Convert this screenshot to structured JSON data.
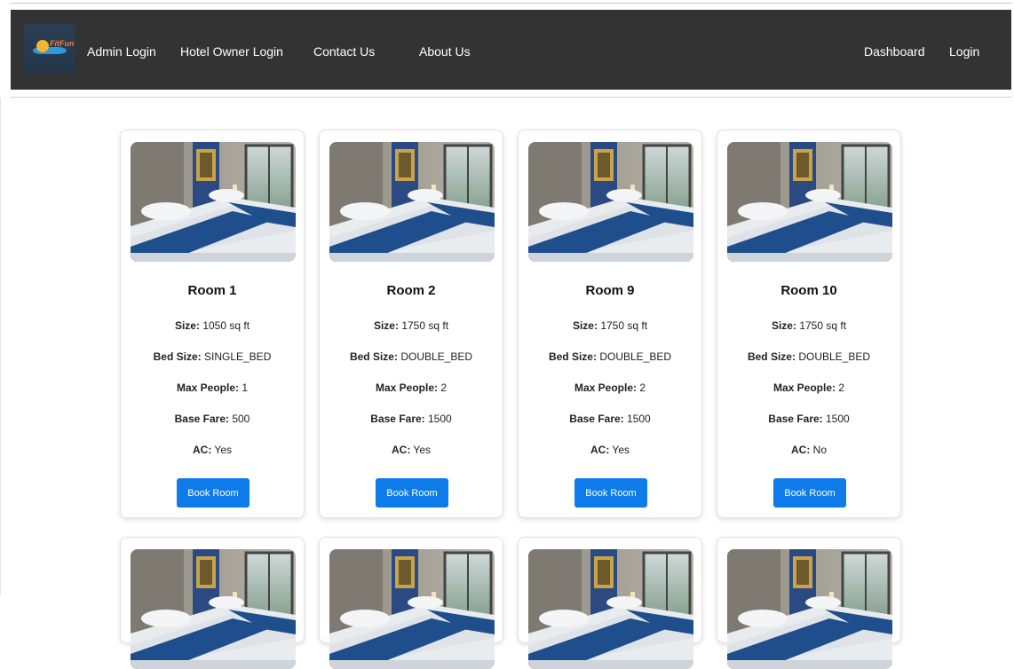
{
  "nav": {
    "logo_text": "FitFun",
    "links_left": [
      "Admin Login",
      "Hotel Owner Login",
      "Contact Us",
      "About Us"
    ],
    "links_right": [
      "Dashboard",
      "Login"
    ]
  },
  "labels": {
    "size": "Size:",
    "bed_size": "Bed Size:",
    "max_people": "Max People:",
    "base_fare": "Base Fare:",
    "ac": "AC:",
    "book_button": "Book Room"
  },
  "rooms": [
    {
      "title": "Room 1",
      "size": "1050 sq ft",
      "bed_size": "SINGLE_BED",
      "max_people": "1",
      "base_fare": "500",
      "ac": "Yes"
    },
    {
      "title": "Room 2",
      "size": "1750 sq ft",
      "bed_size": "DOUBLE_BED",
      "max_people": "2",
      "base_fare": "1500",
      "ac": "Yes"
    },
    {
      "title": "Room 9",
      "size": "1750 sq ft",
      "bed_size": "DOUBLE_BED",
      "max_people": "2",
      "base_fare": "1500",
      "ac": "Yes"
    },
    {
      "title": "Room 10",
      "size": "1750 sq ft",
      "bed_size": "DOUBLE_BED",
      "max_people": "2",
      "base_fare": "1500",
      "ac": "No"
    }
  ],
  "partial_row_count": 4,
  "colors": {
    "navbar": "#333333",
    "button": "#0d7bea",
    "bed_runner": "#1f4e8c"
  }
}
